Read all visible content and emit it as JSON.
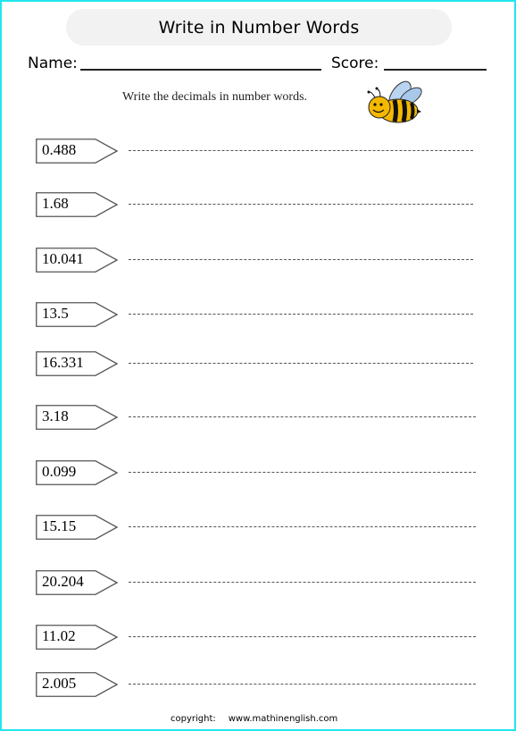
{
  "worksheet": {
    "title": "Write in Number Words",
    "name_label": "Name:",
    "score_label": "Score:",
    "instructions": "Write the decimals in number words.",
    "mascot_icon": "bee-icon",
    "items": [
      {
        "number": "0.488"
      },
      {
        "number": "1.68"
      },
      {
        "number": "10.041"
      },
      {
        "number": "13.5"
      },
      {
        "number": "16.331"
      },
      {
        "number": "3.18"
      },
      {
        "number": "0.099"
      },
      {
        "number": "15.15"
      },
      {
        "number": "20.204"
      },
      {
        "number": "11.02"
      },
      {
        "number": "2.005"
      }
    ],
    "footer": {
      "copyright_label": "copyright:",
      "url": "www.mathinenglish.com"
    },
    "colors": {
      "frame": "#22e6ee",
      "title_pill": "#f2f2f2"
    }
  }
}
